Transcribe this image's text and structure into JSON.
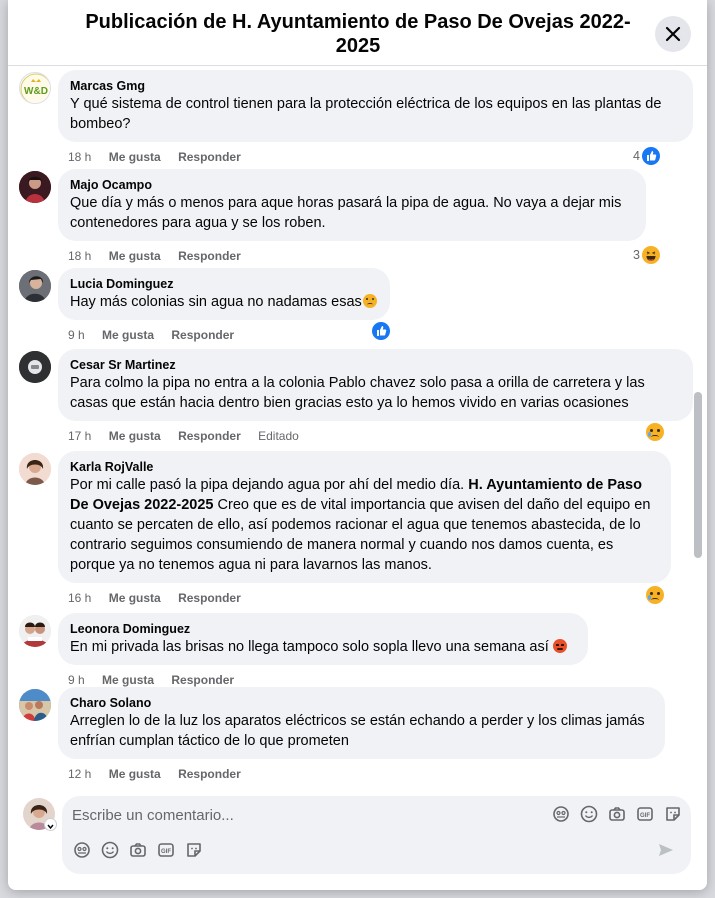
{
  "header": {
    "title": "Publicación de H. Ayuntamiento de Paso De Ovejas 2022-2025"
  },
  "actions": {
    "like": "Me gusta",
    "reply": "Responder"
  },
  "comments": [
    {
      "author": "Marcas Gmg",
      "text": "Y qué sistema de control tienen para la protección eléctrica de los equipos en las plantas de bombeo?",
      "time": "18 h",
      "reaction_count": "4",
      "reaction": "like"
    },
    {
      "author": "Majo Ocampo",
      "text": "Que día y más o menos para aque horas pasará la pipa de agua. No vaya a dejar mis contenedores para agua y se los roben.",
      "time": "18 h",
      "reaction_count": "3",
      "reaction": "haha"
    },
    {
      "author": "Lucia Dominguez",
      "text": "Hay más colonias sin agua no nadamas esas",
      "time": "9 h",
      "reaction": "like"
    },
    {
      "author": "Cesar Sr Martinez",
      "text": "Para colmo la pipa no entra a la colonia Pablo chavez solo pasa a orilla de carretera y las casas que están hacia dentro bien gracias esto ya lo hemos vivido en varias ocasiones",
      "time": "17 h",
      "edited": "Editado",
      "reaction": "sad"
    },
    {
      "author": "Karla RojValle",
      "text_before": "Por mi calle pasó la pipa dejando agua por ahí del medio día. ",
      "mention": "H. Ayuntamiento de Paso De Ovejas 2022-2025",
      "text_after": " Creo que es de vital importancia que avisen del daño del equipo en cuanto se percaten de ello, así podemos racionar el agua que tenemos abastecida, de lo contrario seguimos consumiendo de manera normal y cuando nos damos cuenta, es porque ya no tenemos agua ni para lavarnos las manos.",
      "time": "16 h",
      "reaction": "sad"
    },
    {
      "author": "Leonora Dominguez",
      "text": "En mi privada las brisas no llega tampoco solo sopla llevo una semana así",
      "time": "9 h"
    },
    {
      "author": "Charo Solano",
      "text": "Arreglen lo de la luz los aparatos eléctricos se están echando a perder y los climas jamás enfrían cumplan táctico de lo que prometen",
      "time": "12 h"
    }
  ],
  "composer": {
    "placeholder": "Escribe un comentario..."
  },
  "colors": {
    "like_blue": "#1877f2",
    "bubble_bg": "#f0f2f5",
    "muted_text": "#65676b"
  }
}
